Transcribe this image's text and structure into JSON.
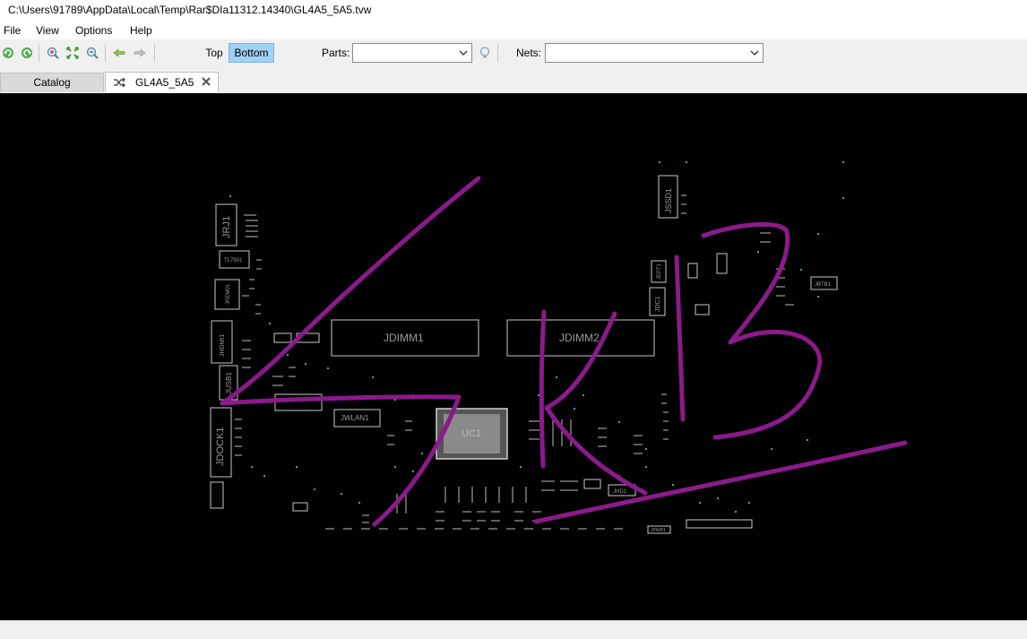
{
  "window": {
    "title": "C:\\Users\\91789\\AppData\\Local\\Temp\\Rar$DIa11312.14340\\GL4A5_5A5.tvw"
  },
  "menu": {
    "file": "File",
    "view": "View",
    "options": "Options",
    "help": "Help"
  },
  "toolbar": {
    "top_label": "Top",
    "bottom_label": "Bottom",
    "parts_label": "Parts:",
    "parts_value": "",
    "nets_label": "Nets:",
    "nets_value": "",
    "active_side": "Bottom",
    "icons": [
      "rotate-ccw-icon",
      "rotate-cw-icon",
      "zoom-in-icon",
      "fit-icon",
      "zoom-out-icon",
      "back-icon",
      "forward-icon",
      "lightbulb-icon"
    ]
  },
  "tabs": {
    "catalog": "Catalog",
    "board": "GL4A5_5A5"
  },
  "board": {
    "labels": {
      "jdimm1": "JDIMM1",
      "jdimm2": "JDIMM2",
      "jssd1": "JSSD1",
      "jrj1": "JRJ1",
      "tl7501": "TL7501",
      "jrem1": "JREM01",
      "jhdmi1": "JHDMI1",
      "jusb1": "JUSB1",
      "jdock1": "JDOCK1",
      "jwlan1": "JWLAN1",
      "uc1": "UC1",
      "jdc1": "JDC1",
      "jbtb1": "JBTB1",
      "jept1": "JEPT1",
      "jhd1": "JHD1",
      "jpwr1": "JPWR1"
    },
    "annotation": "4K13",
    "annotation_color": "#8b1a8b",
    "outline_color": "#c8c8c8",
    "canvas_color": "#000000"
  }
}
